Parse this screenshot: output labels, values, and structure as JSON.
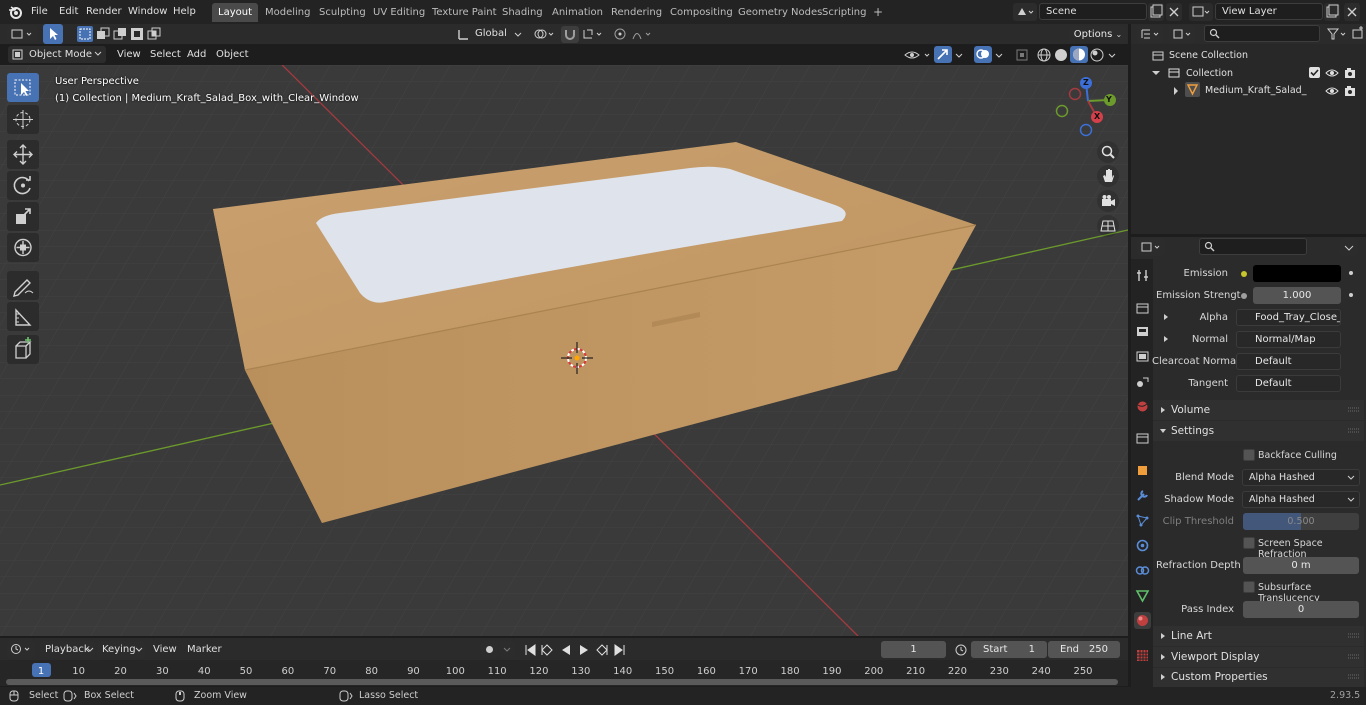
{
  "menu": [
    "File",
    "Edit",
    "Render",
    "Window",
    "Help"
  ],
  "workspace_tabs": [
    {
      "label": "Layout",
      "active": true
    },
    {
      "label": "Modeling"
    },
    {
      "label": "Sculpting"
    },
    {
      "label": "UV Editing"
    },
    {
      "label": "Texture Paint"
    },
    {
      "label": "Shading"
    },
    {
      "label": "Animation"
    },
    {
      "label": "Rendering"
    },
    {
      "label": "Compositing"
    },
    {
      "label": "Geometry Nodes"
    },
    {
      "label": "Scripting"
    }
  ],
  "add_workspace": "+",
  "scene": {
    "name": "Scene"
  },
  "view_layer": {
    "name": "View Layer"
  },
  "viewport_header": {
    "mode": "Object Mode",
    "menus": [
      "View",
      "Select",
      "Add",
      "Object"
    ],
    "orientation": "Global",
    "options": "Options"
  },
  "viewport": {
    "perspective": "User Perspective",
    "collection_info": "(1) Collection | Medium_Kraft_Salad_Box_with_Clear_Window",
    "gizmo": {
      "x": "X",
      "y": "Y",
      "z": "Z"
    }
  },
  "outliner": {
    "scene_collection": "Scene Collection",
    "collection": "Collection",
    "object": "Medium_Kraft_Salad_Box"
  },
  "properties": {
    "rows": [
      {
        "label": "Emission",
        "value": "",
        "type": "color"
      },
      {
        "label": "Emission Strengt",
        "value": "1.000",
        "type": "num"
      },
      {
        "label": "Alpha",
        "value": "Food_Tray_Close_M...",
        "type": "link"
      },
      {
        "label": "Normal",
        "value": "Normal/Map",
        "type": "link"
      },
      {
        "label": "Clearcoat Normal",
        "value": "Default",
        "type": "link"
      },
      {
        "label": "Tangent",
        "value": "Default",
        "type": "link"
      }
    ],
    "volume": "Volume",
    "settings": "Settings",
    "backface_culling": "Backface Culling",
    "blend_mode": {
      "label": "Blend Mode",
      "value": "Alpha Hashed"
    },
    "shadow_mode": {
      "label": "Shadow Mode",
      "value": "Alpha Hashed"
    },
    "clip_threshold": {
      "label": "Clip Threshold",
      "value": "0.500",
      "fraction": 0.5
    },
    "screen_space_refraction": "Screen Space Refraction",
    "refraction_depth": {
      "label": "Refraction Depth",
      "value": "0 m"
    },
    "subsurface_translucency": "Subsurface Translucency",
    "pass_index": {
      "label": "Pass Index",
      "value": "0"
    },
    "line_art": "Line Art",
    "viewport_display": "Viewport Display",
    "custom_properties": "Custom Properties"
  },
  "timeline": {
    "menus": [
      "Playback",
      "Keying",
      "View",
      "Marker"
    ],
    "current_frame": "1",
    "start_label": "Start",
    "start": "1",
    "end_label": "End",
    "end": "250",
    "ticks": [
      "1",
      "10",
      "20",
      "30",
      "40",
      "50",
      "60",
      "70",
      "80",
      "90",
      "100",
      "110",
      "120",
      "130",
      "140",
      "150",
      "160",
      "170",
      "180",
      "190",
      "200",
      "210",
      "220",
      "230",
      "240",
      "250"
    ]
  },
  "statusbar": {
    "select": "Select",
    "box_select": "Box Select",
    "zoom_view": "Zoom View",
    "lasso_select": "Lasso Select",
    "version": "2.93.5"
  },
  "colors": {
    "accent": "#4772b3",
    "box_kraft": "#c29a68",
    "window_film": "#dfe3ec",
    "x_axis": "#a33a40",
    "y_axis": "#6c9a2c",
    "z_axis": "#3d6fd8"
  }
}
